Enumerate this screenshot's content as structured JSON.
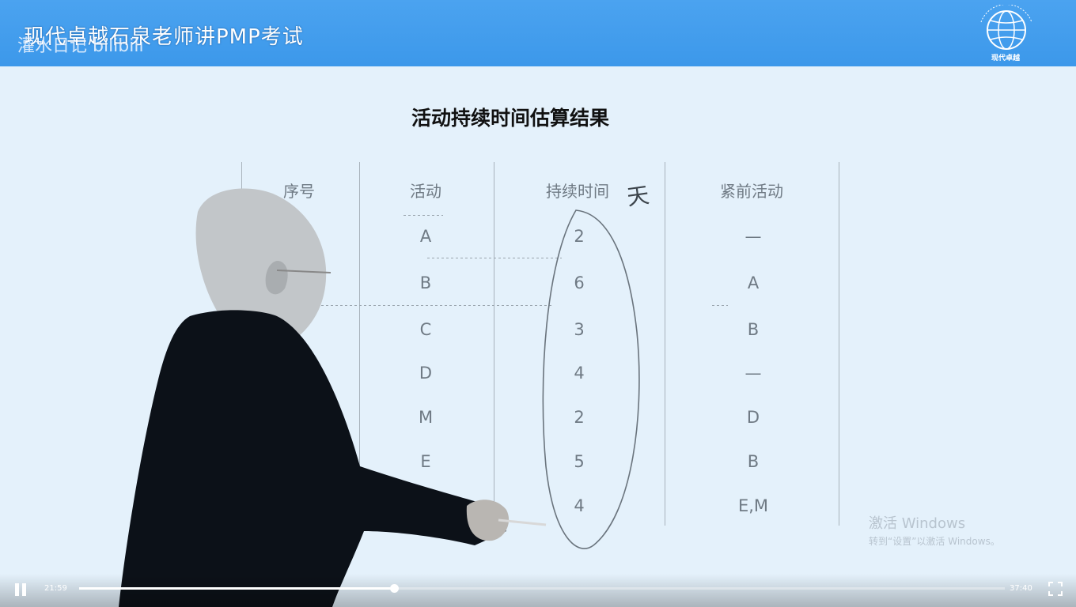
{
  "header": {
    "course_title": "现代卓越石泉老师讲PMP考试",
    "channel_watermark": "灌水日记 bilibili",
    "logo_text": "现代卓越"
  },
  "slide": {
    "title": "活动持续时间估算结果",
    "columns": [
      "序号",
      "活动",
      "持续时间",
      "紧前活动"
    ],
    "rows": [
      {
        "activity": "A",
        "duration": "2",
        "predecessor": "—"
      },
      {
        "activity": "B",
        "duration": "6",
        "predecessor": "A"
      },
      {
        "activity": "C",
        "duration": "3",
        "predecessor": "B"
      },
      {
        "activity": "D",
        "duration": "4",
        "predecessor": "—"
      },
      {
        "activity": "M",
        "duration": "2",
        "predecessor": "D"
      },
      {
        "activity": "E",
        "duration": "5",
        "predecessor": "B"
      },
      {
        "activity": "F",
        "duration": "4",
        "predecessor": "E,M"
      }
    ],
    "annotation_mark": "天"
  },
  "watermark": {
    "title": "激活 Windows",
    "subtitle": "转到“设置”以激活 Windows。"
  },
  "player": {
    "current_time": "21:59",
    "total_time": "37:40",
    "progress_fraction": 0.34,
    "play_state": "pause-icon",
    "accent_color": "#ffffff"
  }
}
